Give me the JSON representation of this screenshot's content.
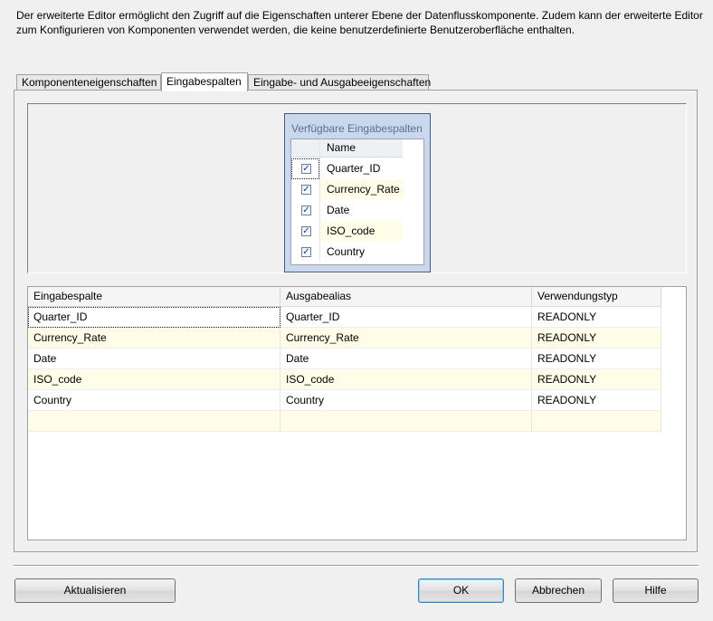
{
  "description": "Der erweiterte Editor ermöglicht den Zugriff auf die Eigenschaften unterer Ebene der Datenflusskomponente. Zudem kann der erweiterte Editor zum Konfigurieren von Komponenten verwendet werden, die keine benutzerdefinierte Benutzeroberfläche enthalten.",
  "tabs": [
    {
      "label": "Komponenteneigenschaften"
    },
    {
      "label": "Eingabespalten"
    },
    {
      "label": "Eingabe- und Ausgabeeigenschaften"
    }
  ],
  "available": {
    "title": "Verfügbare Eingabespalten",
    "name_header": "Name",
    "checkmark": "✓",
    "rows": [
      {
        "name": "Quarter_ID"
      },
      {
        "name": "Currency_Rate"
      },
      {
        "name": "Date"
      },
      {
        "name": "ISO_code"
      },
      {
        "name": "Country"
      }
    ]
  },
  "grid": {
    "headers": [
      "Eingabespalte",
      "Ausgabealias",
      "Verwendungstyp"
    ],
    "rows": [
      {
        "input": "Quarter_ID",
        "alias": "Quarter_ID",
        "usage": "READONLY"
      },
      {
        "input": "Currency_Rate",
        "alias": "Currency_Rate",
        "usage": "READONLY"
      },
      {
        "input": "Date",
        "alias": "Date",
        "usage": "READONLY"
      },
      {
        "input": "ISO_code",
        "alias": "ISO_code",
        "usage": "READONLY"
      },
      {
        "input": "Country",
        "alias": "Country",
        "usage": "READONLY"
      },
      {
        "input": "",
        "alias": "",
        "usage": ""
      }
    ]
  },
  "buttons": {
    "refresh": "Aktualisieren",
    "ok": "OK",
    "cancel": "Abbrechen",
    "help": "Hilfe"
  }
}
